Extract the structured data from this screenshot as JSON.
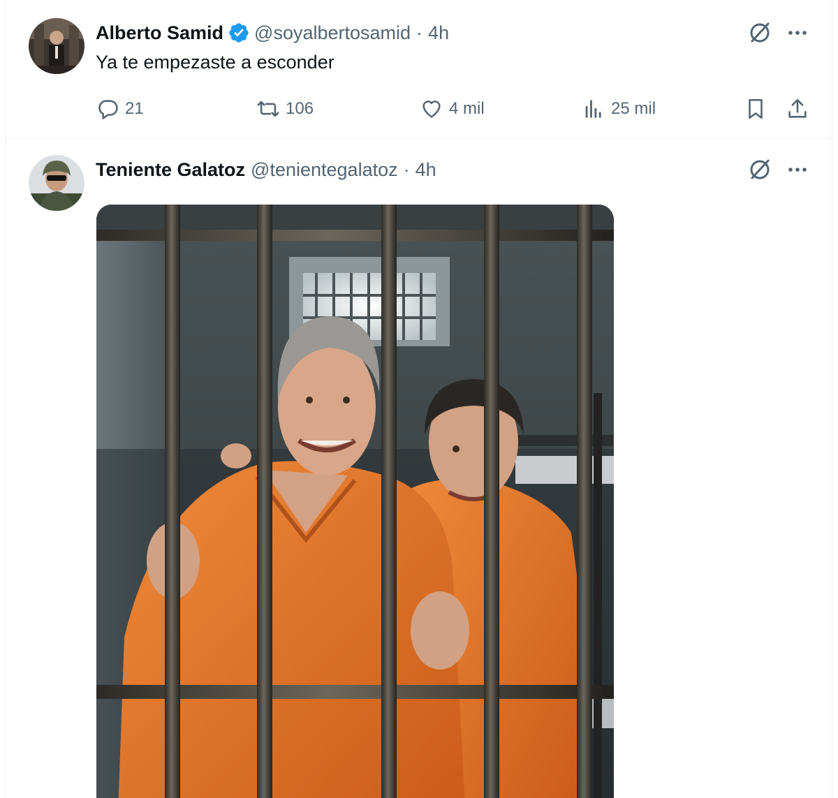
{
  "tweets": [
    {
      "author_name": "Alberto Samid",
      "handle": "@soyalbertosamid",
      "separator": "·",
      "time": "4h",
      "verified": true,
      "text": "Ya te empezaste a esconder",
      "replies": "21",
      "reposts": "106",
      "likes": "4 mil",
      "views": "25 mil"
    },
    {
      "author_name": "Teniente Galatoz",
      "handle": "@tenientegalatoz",
      "separator": "·",
      "time": "4h",
      "verified": false
    }
  ],
  "icons": {
    "verified_color": "#1d9bf0",
    "muted_color": "#536471"
  }
}
